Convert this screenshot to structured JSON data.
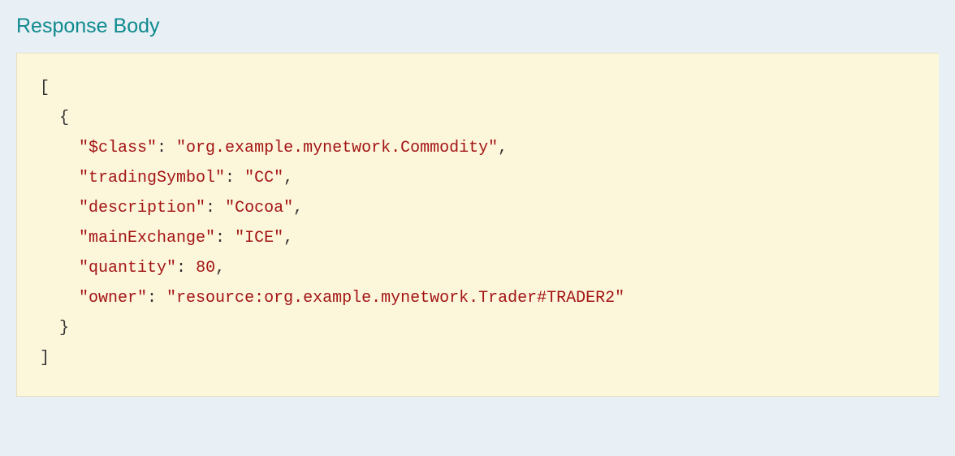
{
  "header": {
    "title": "Response Body"
  },
  "response": {
    "items": [
      {
        "$class": "org.example.mynetwork.Commodity",
        "tradingSymbol": "CC",
        "description": "Cocoa",
        "mainExchange": "ICE",
        "quantity": 80,
        "owner": "resource:org.example.mynetwork.Trader#TRADER2"
      }
    ]
  },
  "keyOrder": [
    "$class",
    "tradingSymbol",
    "description",
    "mainExchange",
    "quantity",
    "owner"
  ]
}
